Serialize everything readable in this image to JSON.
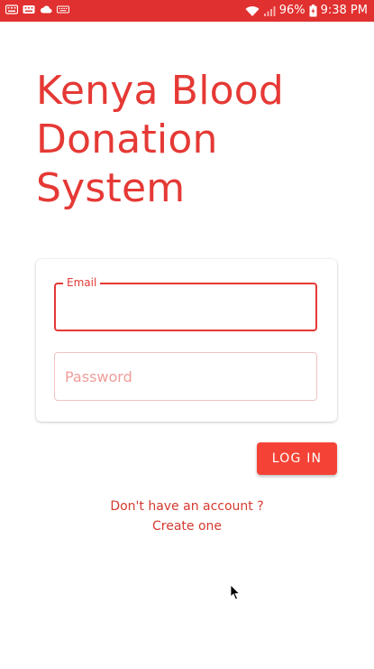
{
  "status_bar": {
    "battery": "96%",
    "time": "9:38 PM",
    "icons": [
      "keyboard-icon",
      "keyboard-icon",
      "cloud-icon",
      "keyboard-icon",
      "wifi-icon",
      "signal-icon",
      "battery-charging-icon"
    ]
  },
  "app": {
    "title": "Kenya Blood Donation System"
  },
  "form": {
    "email_label": "Email",
    "email_value": "",
    "password_placeholder": "Password",
    "password_value": "",
    "login_label": "LOG IN"
  },
  "signup": {
    "prompt": "Don't have an account ?",
    "link": "Create one"
  },
  "colors": {
    "accent": "#e53935",
    "status_bar": "#e0302f",
    "button": "#f44336"
  }
}
